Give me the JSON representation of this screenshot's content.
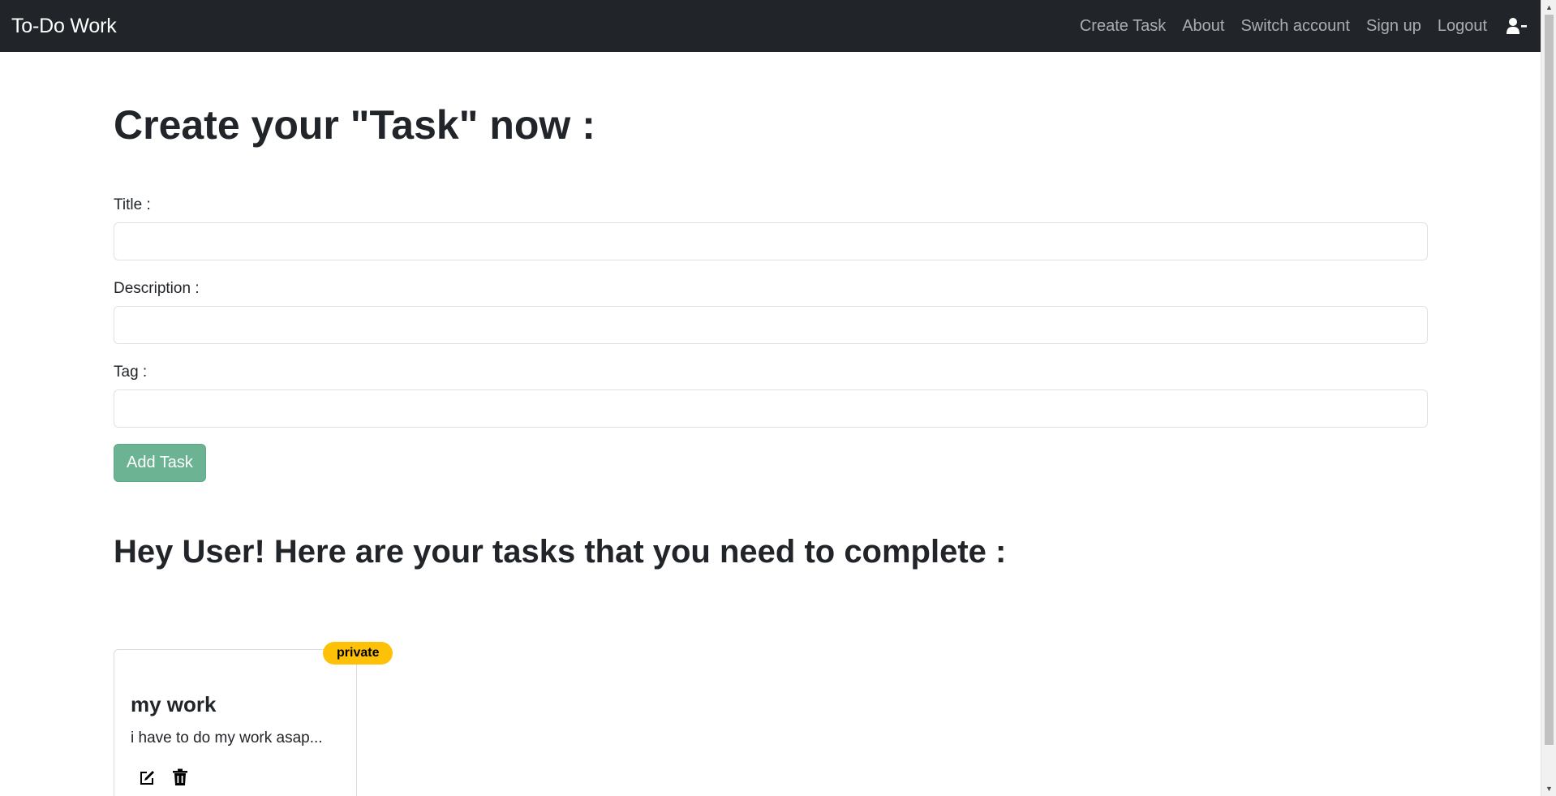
{
  "navbar": {
    "brand": "To-Do Work",
    "links": [
      "Create Task",
      "About",
      "Switch account",
      "Sign up",
      "Logout"
    ],
    "user_icon": "user-minus-icon"
  },
  "form": {
    "heading": "Create your \"Task\" now :",
    "title_label": "Title :",
    "title_value": "",
    "description_label": "Description :",
    "description_value": "",
    "tag_label": "Tag :",
    "tag_value": "",
    "submit_label": "Add Task"
  },
  "tasks": {
    "heading": "Hey User! Here are your tasks that you need to complete :",
    "items": [
      {
        "badge": "private",
        "title": "my work",
        "description": "i have to do my work asap...",
        "edit_icon": "edit-icon",
        "delete_icon": "trash-icon"
      }
    ]
  },
  "colors": {
    "navbar_bg": "#212529",
    "button_bg": "#6bb392",
    "badge_bg": "#ffc107"
  }
}
